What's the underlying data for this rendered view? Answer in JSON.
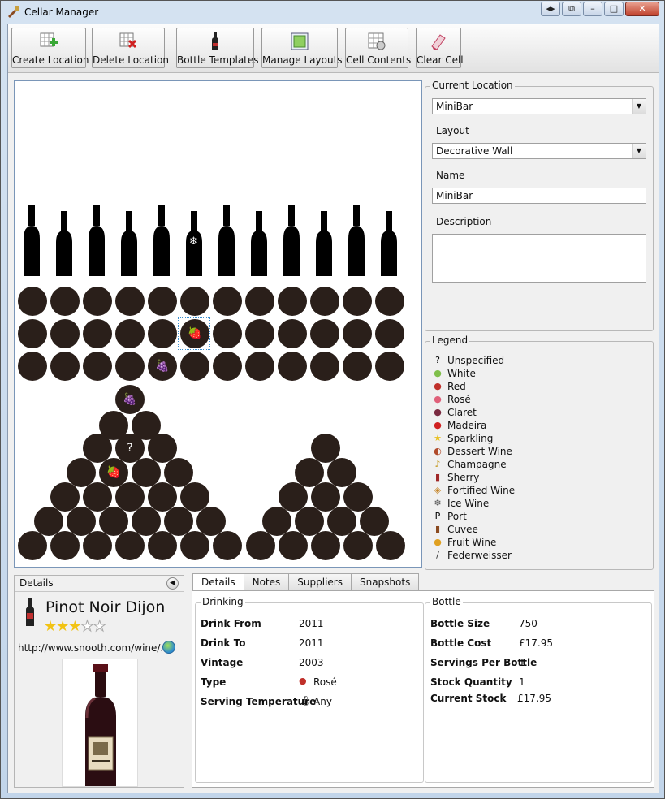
{
  "window": {
    "title": "Cellar Manager",
    "sys_buttons": [
      "◂▸",
      "⧉",
      "–",
      "□",
      "✕"
    ]
  },
  "toolbar": {
    "buttons": [
      {
        "label": "Create Location",
        "icon": "create-location-icon"
      },
      {
        "label": "Delete Location",
        "icon": "delete-location-icon"
      },
      {
        "label": "Bottle Templates",
        "icon": "bottle-templates-icon"
      },
      {
        "label": "Manage Layouts",
        "icon": "manage-layouts-icon"
      },
      {
        "label": "Cell Contents",
        "icon": "cell-contents-icon"
      },
      {
        "label": "Clear Cell",
        "icon": "clear-cell-icon"
      }
    ]
  },
  "cell_glyphs": {
    "ice": "❄",
    "rose": "🍓",
    "white": "🍇",
    "unspecified": "?"
  },
  "current_location": {
    "group_title": "Current Location",
    "location_value": "MiniBar",
    "layout_label": "Layout",
    "layout_value": "Decorative Wall",
    "name_label": "Name",
    "name_value": "MiniBar",
    "description_label": "Description",
    "description_value": ""
  },
  "legend": {
    "title": "Legend",
    "items": [
      {
        "label": "Unspecified",
        "icon": "?",
        "color": "#000000"
      },
      {
        "label": "White",
        "icon": "●",
        "color": "#7fbf4a"
      },
      {
        "label": "Red",
        "icon": "●",
        "color": "#c0302a"
      },
      {
        "label": "Rosé",
        "icon": "●",
        "color": "#e0607a"
      },
      {
        "label": "Claret",
        "icon": "●",
        "color": "#7a2a40"
      },
      {
        "label": "Madeira",
        "icon": "●",
        "color": "#d02020"
      },
      {
        "label": "Sparkling",
        "icon": "★",
        "color": "#e8c020"
      },
      {
        "label": "Dessert Wine",
        "icon": "◐",
        "color": "#b04a2a"
      },
      {
        "label": "Champagne",
        "icon": "♪",
        "color": "#c8a030"
      },
      {
        "label": "Sherry",
        "icon": "▮",
        "color": "#a02828"
      },
      {
        "label": "Fortified Wine",
        "icon": "◈",
        "color": "#c88a30"
      },
      {
        "label": "Ice Wine",
        "icon": "❄",
        "color": "#444444"
      },
      {
        "label": "Port",
        "icon": "P",
        "color": "#000000"
      },
      {
        "label": "Cuvee",
        "icon": "▮",
        "color": "#8a4a20"
      },
      {
        "label": "Fruit Wine",
        "icon": "●",
        "color": "#e0a020"
      },
      {
        "label": "Federweisser",
        "icon": "/",
        "color": "#333333"
      }
    ]
  },
  "details": {
    "title": "Details",
    "wine_name": "Pinot Noir Dijon",
    "rating": 3,
    "rating_max": 5,
    "url": "http://www.snooth.com/wine/..."
  },
  "tabs": [
    "Details",
    "Notes",
    "Suppliers",
    "Snapshots"
  ],
  "drinking": {
    "title": "Drinking",
    "rows": [
      {
        "label": "Drink From",
        "value": "2011"
      },
      {
        "label": "Drink To",
        "value": "2011"
      },
      {
        "label": "Vintage",
        "value": "2003"
      },
      {
        "label": "Type",
        "value": "Rosé"
      },
      {
        "label": "Serving Temperature",
        "value": "Any"
      }
    ]
  },
  "bottle": {
    "title": "Bottle",
    "rows": [
      {
        "label": "Bottle Size",
        "value": "750"
      },
      {
        "label": "Bottle Cost",
        "value": "£17.95"
      },
      {
        "label": "Servings Per Bottle",
        "value": "1"
      },
      {
        "label": "Stock Quantity",
        "value": "1"
      },
      {
        "label": "Current Stock",
        "value": "£17.95"
      }
    ]
  }
}
